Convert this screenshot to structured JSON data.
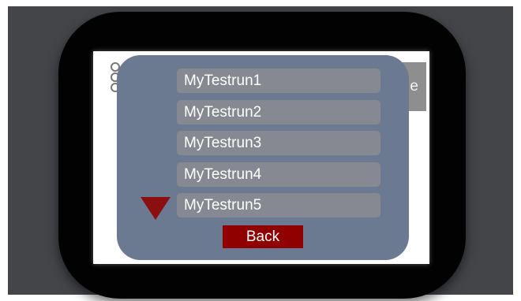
{
  "background_screen": {
    "partial_button_text": "e"
  },
  "popup": {
    "runs": [
      {
        "label": "MyTestrun1"
      },
      {
        "label": "MyTestrun2"
      },
      {
        "label": "MyTestrun3"
      },
      {
        "label": "MyTestrun4"
      },
      {
        "label": "MyTestrun5"
      }
    ],
    "scroll_icon": "triangle-down-icon",
    "back_label": "Back"
  },
  "colors": {
    "outer_frame": "#434549",
    "bezel": "#020202",
    "popup_background": "#6c7a91",
    "run_item_background": "#868991",
    "accent_red": "#900000"
  }
}
